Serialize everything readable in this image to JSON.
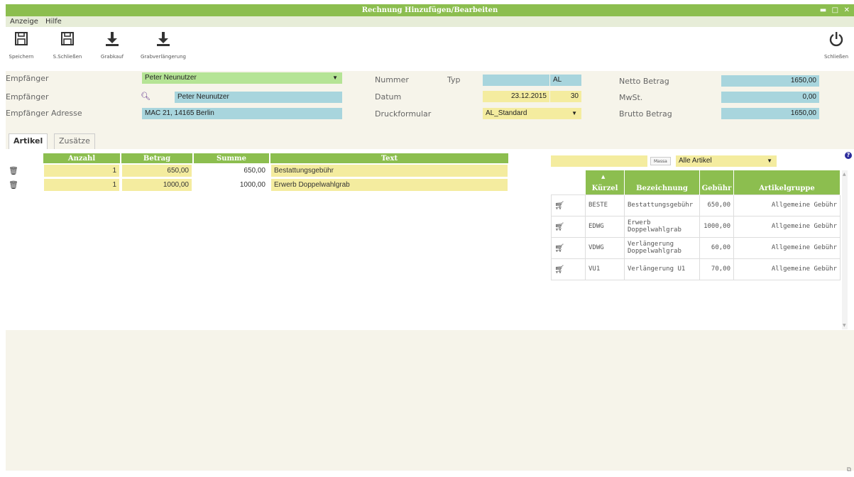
{
  "window": {
    "title": "Rechnung Hinzufügen/Bearbeiten",
    "controls": "▬ □ ✕"
  },
  "menu": [
    "Anzeige",
    "Hilfe"
  ],
  "toolbar": {
    "save": "Speichern",
    "save_close": "S.Schließen",
    "grabkauf": "Grabkauf",
    "grabverlaengerung": "Grabverlängerung",
    "close": "Schließen"
  },
  "form": {
    "empfaenger_label": "Empfänger",
    "empfaenger_value": "Peter Neunutzer",
    "empfaenger2_label": "Empfänger",
    "empfaenger2_value": "Peter Neunutzer",
    "adresse_label": "Empfänger Adresse",
    "adresse_value": "MAC 21, 14165 Berlin",
    "nummer_label": "Nummer",
    "typ_label": "Typ",
    "nummer_value": "",
    "typ_value": "AL",
    "datum_label": "Datum",
    "datum_value": "23.12.2015",
    "datum_days": "30",
    "druckformular_label": "Druckformular",
    "druckformular_value": "AL_Standard",
    "netto_label": "Netto Betrag",
    "netto_value": "1650,00",
    "mwst_label": "MwSt.",
    "mwst_value": "0,00",
    "brutto_label": "Brutto Betrag",
    "brutto_value": "1650,00"
  },
  "tabs": [
    "Artikel",
    "Zusätze"
  ],
  "positions": {
    "headers": [
      "Anzahl",
      "Betrag",
      "Summe",
      "Text"
    ],
    "rows": [
      {
        "anzahl": "1",
        "betrag": "650,00",
        "summe": "650,00",
        "text": "Bestattungsgebühr"
      },
      {
        "anzahl": "1",
        "betrag": "1000,00",
        "summe": "1000,00",
        "text": "Erwerb Doppelwahlgrab"
      }
    ]
  },
  "articles": {
    "search_value": "",
    "search_button": "Massa",
    "filter_value": "Alle Artikel",
    "headers": [
      "Kürzel",
      "Bezeichnung",
      "Gebühr",
      "Artikelgruppe"
    ],
    "rows": [
      {
        "kuerzel": "BESTE",
        "bezeichnung": "Bestattungsgebühr",
        "gebuehr": "650,00",
        "gruppe": "Allgemeine Gebühr"
      },
      {
        "kuerzel": "EDWG",
        "bezeichnung": "Erwerb Doppelwahlgrab",
        "gebuehr": "1000,00",
        "gruppe": "Allgemeine Gebühr"
      },
      {
        "kuerzel": "VDWG",
        "bezeichnung": "Verlängerung Doppelwahlgrab",
        "gebuehr": "60,00",
        "gruppe": "Allgemeine Gebühr"
      },
      {
        "kuerzel": "VU1",
        "bezeichnung": "Verlängerung U1",
        "gebuehr": "70,00",
        "gruppe": "Allgemeine Gebühr"
      }
    ]
  }
}
